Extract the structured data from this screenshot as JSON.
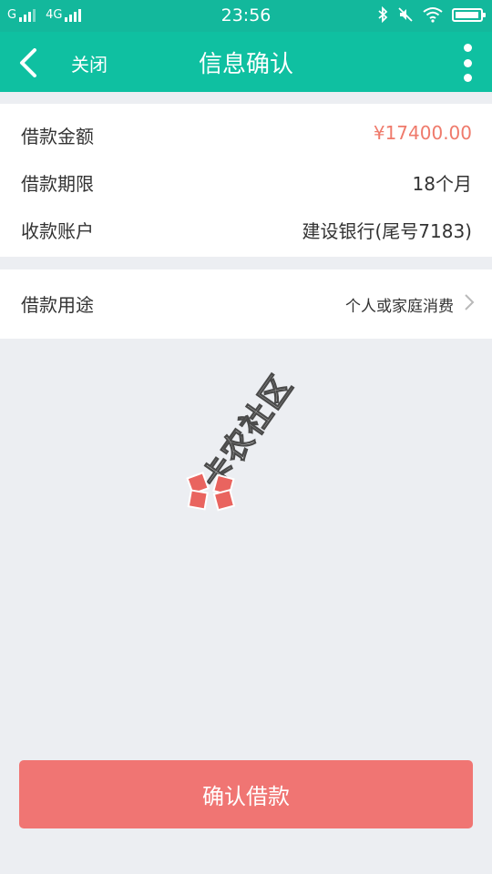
{
  "status_bar": {
    "carrier1": "G",
    "carrier2": "4G",
    "time": "23:56",
    "battery_level": 0.95
  },
  "nav": {
    "close_label": "关闭",
    "title": "信息确认"
  },
  "loan_info": {
    "amount": {
      "label": "借款金额",
      "value": "¥17400.00"
    },
    "term": {
      "label": "借款期限",
      "value": "18个月"
    },
    "account": {
      "label": "收款账户",
      "value": "建设银行(尾号7183)"
    }
  },
  "purpose": {
    "label": "借款用途",
    "value": "个人或家庭消费"
  },
  "watermark": {
    "text": "卡农社区"
  },
  "confirm_button": {
    "label": "确认借款"
  },
  "colors": {
    "header_bg": "#0fc0a1",
    "amount_text": "#ef7a6b",
    "button_bg": "#f07573",
    "page_bg": "#eceef2"
  }
}
